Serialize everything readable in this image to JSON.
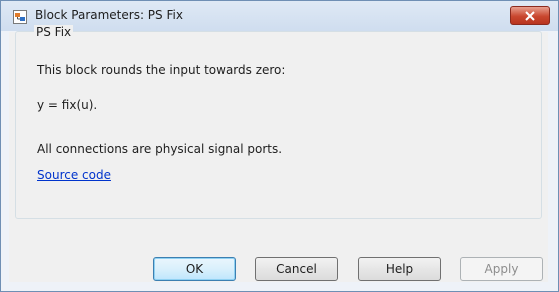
{
  "window": {
    "title": "Block Parameters: PS Fix"
  },
  "group": {
    "legend": "PS Fix",
    "description": "This block rounds the input towards zero:",
    "formula": "y = fix(u).",
    "connections": "All connections are physical signal ports.",
    "source_link": "Source code"
  },
  "buttons": {
    "ok": "OK",
    "cancel": "Cancel",
    "help": "Help",
    "apply": "Apply"
  },
  "colors": {
    "close_button": "#c9472f",
    "link": "#0033cc",
    "default_button_border": "#3c7fb1"
  },
  "icons": {
    "title_icon": "simulink-block-icon",
    "close_icon": "close-x-icon"
  }
}
